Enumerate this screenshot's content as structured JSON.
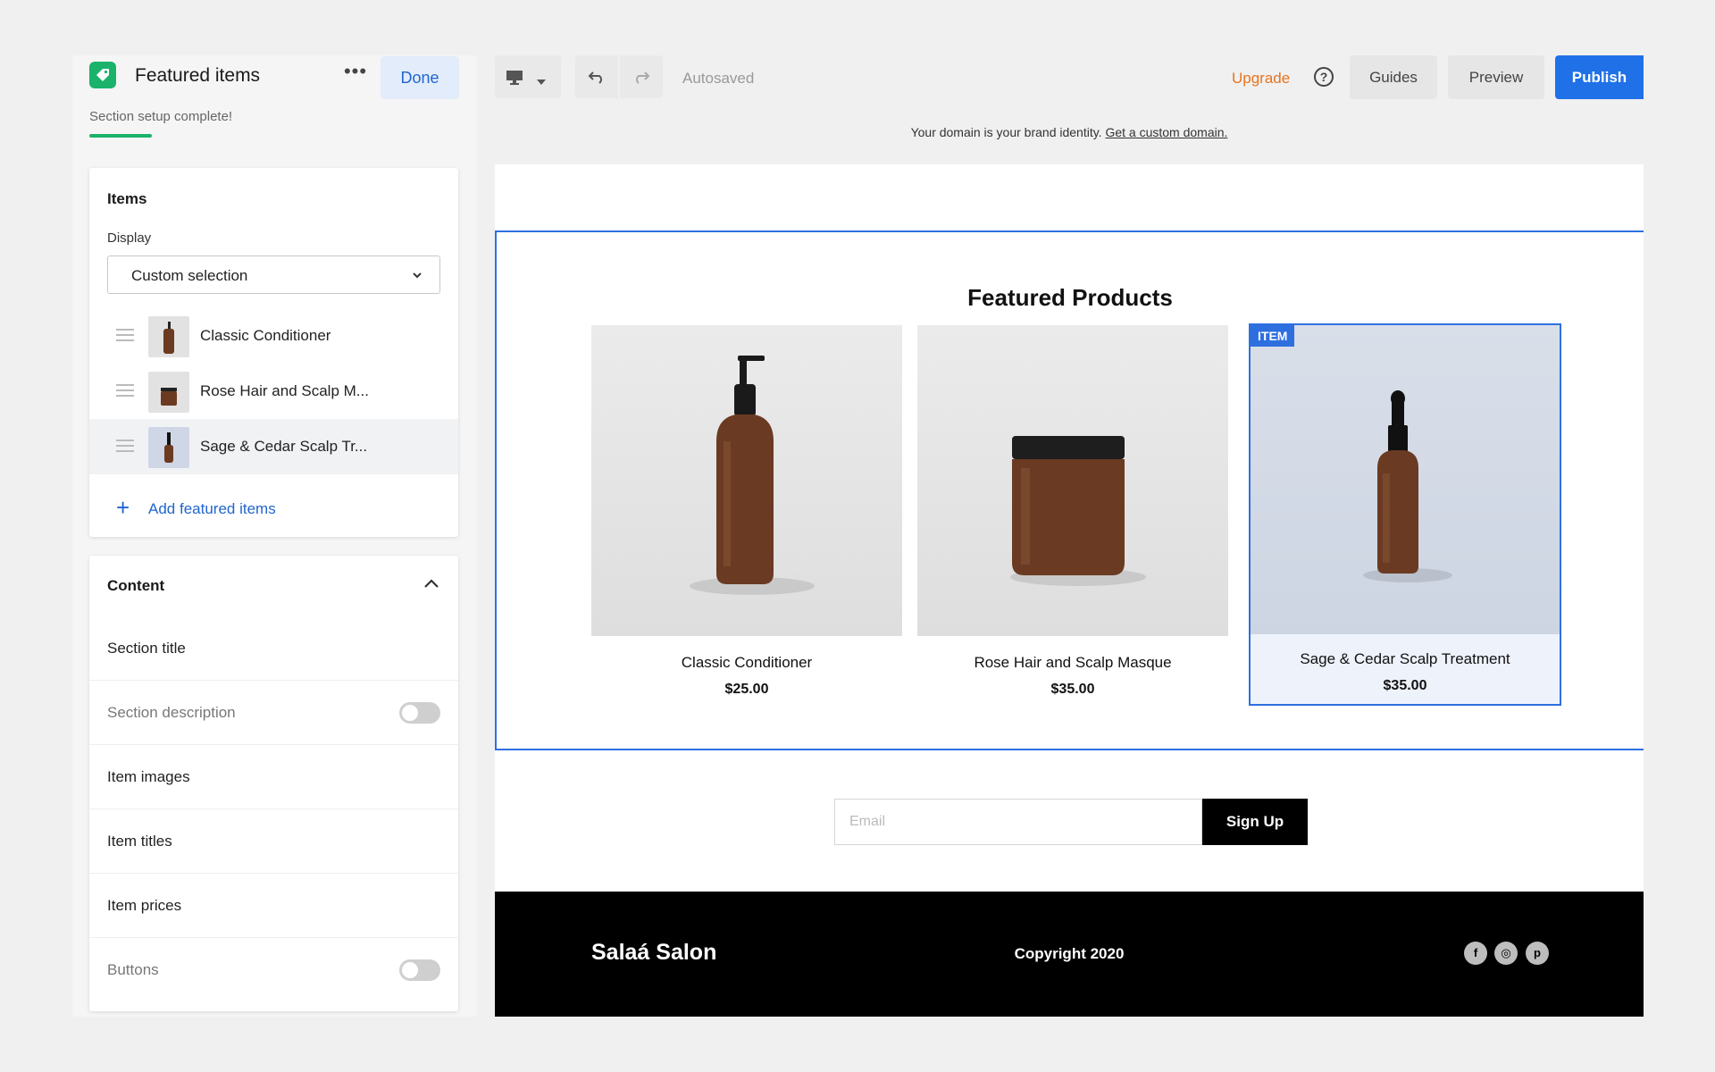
{
  "panel": {
    "title": "Featured items",
    "more_label": "•••",
    "done_label": "Done",
    "subtitle": "Section setup complete!",
    "items_card": {
      "title": "Items",
      "display_label": "Display",
      "display_value": "Custom selection",
      "items": [
        {
          "label": "Classic Conditioner"
        },
        {
          "label": "Rose Hair and Scalp M..."
        },
        {
          "label": "Sage & Cedar Scalp Tr..."
        }
      ],
      "add_label": "Add featured items"
    },
    "content_card": {
      "title": "Content",
      "rows": [
        {
          "label": "Section title"
        },
        {
          "label": "Section description"
        },
        {
          "label": "Item images"
        },
        {
          "label": "Item titles"
        },
        {
          "label": "Item prices"
        },
        {
          "label": "Buttons"
        }
      ]
    }
  },
  "topbar": {
    "autosaved": "Autosaved",
    "upgrade": "Upgrade",
    "help": "?",
    "guides": "Guides",
    "preview": "Preview",
    "publish": "Publish"
  },
  "domain_bar": {
    "text": "Your domain is your brand identity.",
    "link": "Get a custom domain."
  },
  "site": {
    "section_title": "Featured Products",
    "badge": "ITEM",
    "products": [
      {
        "name": "Classic Conditioner",
        "price": "$25.00"
      },
      {
        "name": "Rose Hair and Scalp Masque",
        "price": "$35.00"
      },
      {
        "name": "Sage & Cedar Scalp Treatment",
        "price": "$35.00"
      }
    ],
    "signup": {
      "email_placeholder": "Email",
      "button": "Sign Up"
    },
    "footer": {
      "brand": "Salaá Salon",
      "copyright": "Copyright 2020",
      "social": [
        {
          "icon": "facebook-icon",
          "glyph": "f"
        },
        {
          "icon": "instagram-icon",
          "glyph": "◎"
        },
        {
          "icon": "pinterest-icon",
          "glyph": "p"
        }
      ]
    }
  },
  "colors": {
    "accent_blue": "#2071e8",
    "brand_green": "#1bb26b",
    "upgrade_orange": "#e8741e"
  }
}
